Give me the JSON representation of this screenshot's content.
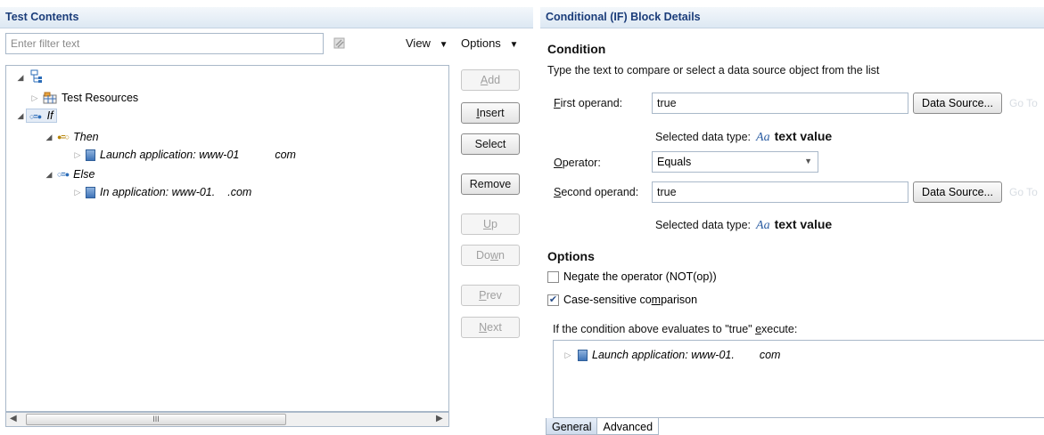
{
  "left_panel": {
    "title": "Test Contents",
    "filter_placeholder": "Enter filter text",
    "view_menu": "View",
    "options_menu": "Options",
    "tree": {
      "root_label": "",
      "test_resources": "Test Resources",
      "if_label": "If",
      "then_label": "Then",
      "launch_prefix": "Launch application: www-01",
      "launch_suffix": "com",
      "else_label": "Else",
      "inapp_prefix": "In application: www-01.",
      "inapp_suffix": ".com"
    },
    "buttons": {
      "add_pre": "",
      "add_key": "A",
      "add_post": "dd",
      "insert_pre": "",
      "insert_key": "I",
      "insert_post": "nsert",
      "select": "Select",
      "remove": "Remove",
      "up_pre": "",
      "up_key": "U",
      "up_post": "p",
      "down_pre": "Do",
      "down_key": "w",
      "down_post": "n",
      "prev_pre": "",
      "prev_key": "P",
      "prev_post": "rev",
      "next_pre": "",
      "next_key": "N",
      "next_post": "ext"
    },
    "scroll_thumb": "III"
  },
  "right_panel": {
    "title": "Conditional (IF) Block Details",
    "condition_heading": "Condition",
    "condition_desc": "Type the text to compare or select a data source object from the list",
    "first_operand": {
      "label_key": "F",
      "label_rest": "irst operand:",
      "value": "true",
      "button": "Data Source...",
      "ghost": "Go To"
    },
    "selected_type_label": "Selected data type:",
    "aa_glyph": "Aa",
    "type_value": "text value",
    "operator": {
      "label_key": "O",
      "label_rest": "perator:",
      "value": "Equals"
    },
    "second_operand": {
      "label_key": "S",
      "label_rest": "econd operand:",
      "value": "true",
      "button": "Data Source...",
      "ghost": "Go To"
    },
    "options_heading": "Options",
    "negate": {
      "pre": "Ne",
      "key": "g",
      "post": "ate the operator (NOT(op))",
      "checked": false
    },
    "case_sensitive": {
      "pre": "Case-sensitive co",
      "key": "m",
      "post": "parison",
      "checked": true
    },
    "exec_desc_pre": "If the condition above evaluates to \"true\" ",
    "exec_desc_key": "e",
    "exec_desc_post": "xecute:",
    "exec_item_prefix": "Launch application: www-01.",
    "exec_item_suffix": "com",
    "tabs": [
      "General",
      "Advanced"
    ]
  },
  "colors": {
    "header_text": "#1b3d7a",
    "icon_blue": "#2b6cb8"
  }
}
